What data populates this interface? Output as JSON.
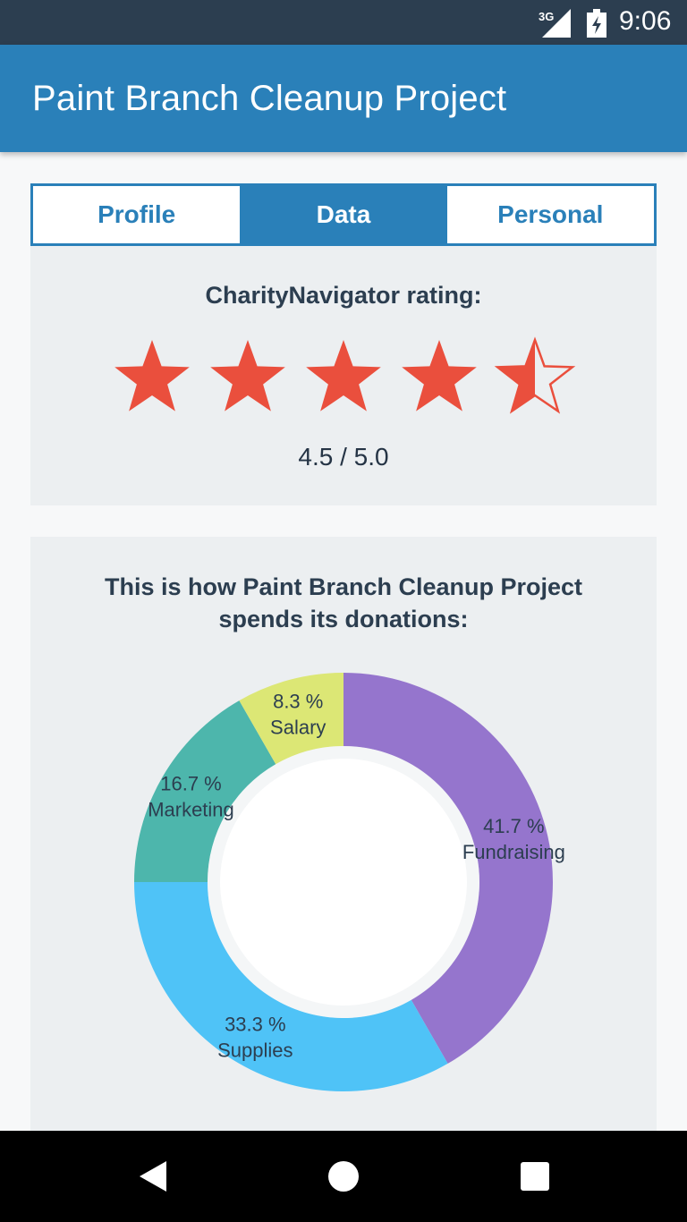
{
  "status_bar": {
    "network": "3G",
    "time": "9:06"
  },
  "app_bar": {
    "title": "Paint Branch Cleanup Project"
  },
  "tabs": [
    {
      "label": "Profile",
      "active": false
    },
    {
      "label": "Data",
      "active": true
    },
    {
      "label": "Personal",
      "active": false
    }
  ],
  "rating": {
    "title": "CharityNavigator rating:",
    "value_text": "4.5 / 5.0",
    "stars": [
      1,
      1,
      1,
      1,
      0.5
    ],
    "star_color": "#ea4f3d"
  },
  "donations": {
    "title": "This is how Paint Branch Cleanup Project spends its donations:"
  },
  "chart_data": {
    "type": "pie",
    "donut": true,
    "categories": [
      "Fundraising",
      "Supplies",
      "Marketing",
      "Salary"
    ],
    "values": [
      41.7,
      33.3,
      16.7,
      8.3
    ],
    "value_labels": [
      "41.7 %",
      "33.3 %",
      "16.7 %",
      "8.3 %"
    ],
    "colors": [
      "#9575cd",
      "#4fc3f7",
      "#4db6ac",
      "#dce775"
    ],
    "title": "This is how Paint Branch Cleanup Project spends its donations:"
  },
  "nav_bar": {
    "buttons": [
      "back-icon",
      "home-icon",
      "recents-icon"
    ]
  }
}
